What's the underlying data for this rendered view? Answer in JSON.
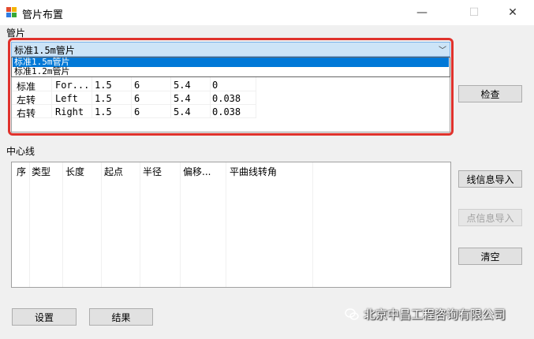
{
  "window": {
    "title": "管片布置",
    "minimize_glyph": "—",
    "maximize_glyph": "☐",
    "close_glyph": "✕"
  },
  "segment_group": {
    "label": "管片",
    "combo_selected": "标准1.5m管片",
    "dropdown_options": [
      "标准1.5m管片",
      "标准1.2m管片"
    ],
    "rows": [
      [
        "标准",
        "For...",
        "1.5",
        "6",
        "5.4",
        "0"
      ],
      [
        "左转",
        "Left",
        "1.5",
        "6",
        "5.4",
        "0.038"
      ],
      [
        "右转",
        "Right",
        "1.5",
        "6",
        "5.4",
        "0.038"
      ]
    ],
    "check_button": "检查"
  },
  "centerline_group": {
    "label": "中心线",
    "columns": [
      "序",
      "类型",
      "长度",
      "起点",
      "半径",
      "偏移...",
      "平曲线转角"
    ],
    "import_line_button": "线信息导入",
    "import_point_button": "点信息导入",
    "clear_button": "清空"
  },
  "footer": {
    "settings_button": "设置",
    "results_button": "结果"
  },
  "watermark": {
    "text": "北京中昌工程咨询有限公司"
  },
  "colors": {
    "highlight": "#e0322c",
    "selection": "#0078d7",
    "combo_bg": "#cce4f7"
  }
}
